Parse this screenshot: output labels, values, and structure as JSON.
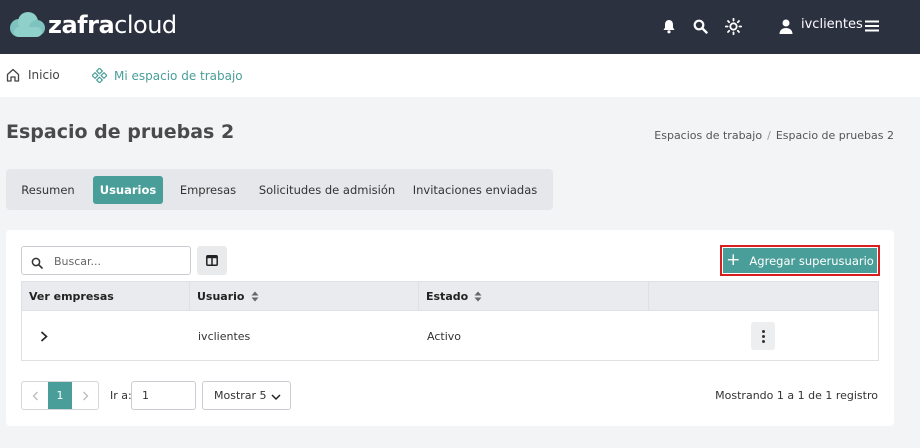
{
  "header": {
    "logo_bold": "zafra",
    "logo_light": "cloud",
    "user_name": "ivclientes",
    "icons": [
      "bell-icon",
      "search-icon",
      "sun-icon",
      "user-icon",
      "menu-icon"
    ]
  },
  "nav": {
    "home_label": "Inicio",
    "workspace_label": "Mi espacio de trabajo"
  },
  "page": {
    "title": "Espacio de pruebas 2",
    "breadcrumb": [
      "Espacios de trabajo",
      "Espacio de pruebas 2"
    ],
    "breadcrumb_sep": "/"
  },
  "tabs": [
    {
      "label": "Resumen",
      "active": false
    },
    {
      "label": "Usuarios",
      "active": true
    },
    {
      "label": "Empresas",
      "active": false
    },
    {
      "label": "Solicitudes de admisión",
      "active": false
    },
    {
      "label": "Invitaciones enviadas",
      "active": false
    }
  ],
  "toolbar": {
    "search_placeholder": "Buscar...",
    "add_label": "Agregar superusuario"
  },
  "table": {
    "headers": [
      "Ver empresas",
      "Usuario",
      "Estado",
      ""
    ],
    "rows": [
      {
        "user": "ivclientes",
        "status": "Activo"
      }
    ]
  },
  "pagination": {
    "current_page": "1",
    "goto_label": "Ir a:",
    "goto_value": "1",
    "show_label": "Mostrar 5",
    "summary": "Mostrando 1 a 1 de 1 registro"
  },
  "colors": {
    "topbar": "#2c3140",
    "accent": "#4a9e99",
    "highlight_border": "#d81e1e"
  }
}
